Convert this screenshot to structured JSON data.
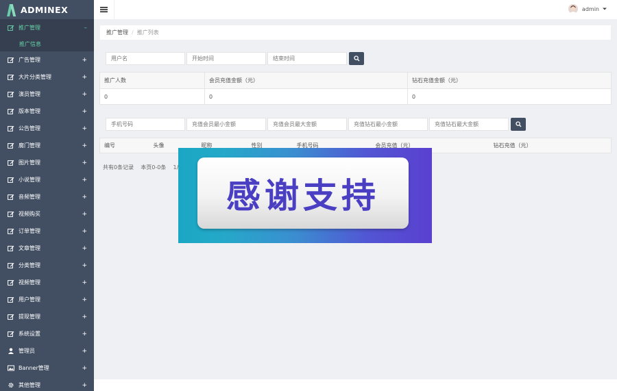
{
  "brand": {
    "name": "ADMINEX"
  },
  "sidebar": {
    "items": [
      {
        "label": "推广管理",
        "icon": "edit-icon",
        "sign": "–",
        "active": true
      },
      {
        "label": "广告管理",
        "icon": "edit-icon",
        "sign": "+"
      },
      {
        "label": "大片分类管理",
        "icon": "edit-icon",
        "sign": "+"
      },
      {
        "label": "演员管理",
        "icon": "edit-icon",
        "sign": "+"
      },
      {
        "label": "版本管理",
        "icon": "edit-icon",
        "sign": "+"
      },
      {
        "label": "公告管理",
        "icon": "edit-icon",
        "sign": "+"
      },
      {
        "label": "腐门管理",
        "icon": "edit-icon",
        "sign": "+"
      },
      {
        "label": "图片管理",
        "icon": "edit-icon",
        "sign": "+"
      },
      {
        "label": "小说管理",
        "icon": "edit-icon",
        "sign": "+"
      },
      {
        "label": "音频管理",
        "icon": "edit-icon",
        "sign": "+"
      },
      {
        "label": "视频购买",
        "icon": "edit-icon",
        "sign": "+"
      },
      {
        "label": "订单管理",
        "icon": "edit-icon",
        "sign": "+"
      },
      {
        "label": "文章管理",
        "icon": "edit-icon",
        "sign": "+"
      },
      {
        "label": "分类管理",
        "icon": "edit-icon",
        "sign": "+"
      },
      {
        "label": "视频管理",
        "icon": "edit-icon",
        "sign": "+"
      },
      {
        "label": "用户管理",
        "icon": "edit-icon",
        "sign": "+"
      },
      {
        "label": "提现管理",
        "icon": "edit-icon",
        "sign": "+"
      },
      {
        "label": "系统设置",
        "icon": "edit-icon",
        "sign": "+"
      },
      {
        "label": "管理员",
        "icon": "user-icon",
        "sign": "+"
      },
      {
        "label": "Banner管理",
        "icon": "image-icon",
        "sign": "+"
      },
      {
        "label": "其他管理",
        "icon": "gear-icon",
        "sign": "+"
      }
    ],
    "submenu": {
      "label": "推广信息"
    }
  },
  "topbar": {
    "username": "admin"
  },
  "breadcrumb": {
    "parent": "推广管理",
    "current": "推广列表"
  },
  "search1": {
    "username_placeholder": "用户名",
    "start_placeholder": "开始时间",
    "end_placeholder": "结束时间"
  },
  "summary_table": {
    "headers": [
      "推广人数",
      "会员充值金额（元）",
      "钻石充值金额（元）"
    ],
    "row": [
      "0",
      "0",
      "0"
    ]
  },
  "search2": {
    "phone_placeholder": "手机号码",
    "vip_min_placeholder": "充值会员最小金额",
    "vip_max_placeholder": "充值会员最大金额",
    "diamond_min_placeholder": "充值钻石最小金额",
    "diamond_max_placeholder": "充值钻石最大金额"
  },
  "list_table": {
    "headers": [
      "编号",
      "头像",
      "昵称",
      "性别",
      "手机号码",
      "会员充值（元）",
      "钻石充值（元）"
    ]
  },
  "pagination": {
    "total": "共有0条记录",
    "page": "本页0-0条",
    "current": "1/"
  },
  "banner": {
    "text": "感谢支持"
  }
}
